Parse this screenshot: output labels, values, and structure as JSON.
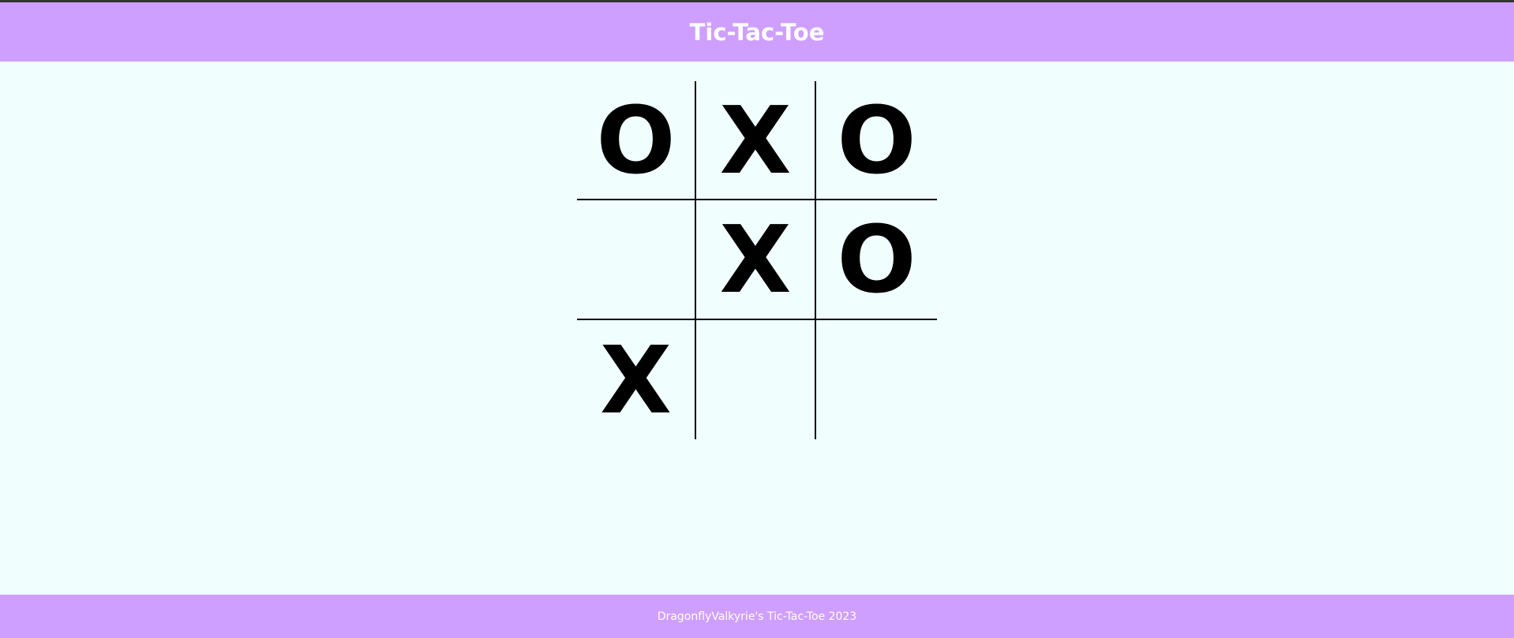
{
  "header": {
    "title": "Tic-Tac-Toe"
  },
  "board": {
    "cells": [
      "O",
      "X",
      "O",
      "",
      "X",
      "O",
      "X",
      "",
      ""
    ]
  },
  "footer": {
    "text": "DragonflyValkyrie's Tic-Tac-Toe 2023"
  },
  "colors": {
    "header_bg": "#cf9fff",
    "page_bg": "#f0fffe",
    "mark": "#000000",
    "grid_line": "#000000",
    "header_text": "#ffffff"
  }
}
